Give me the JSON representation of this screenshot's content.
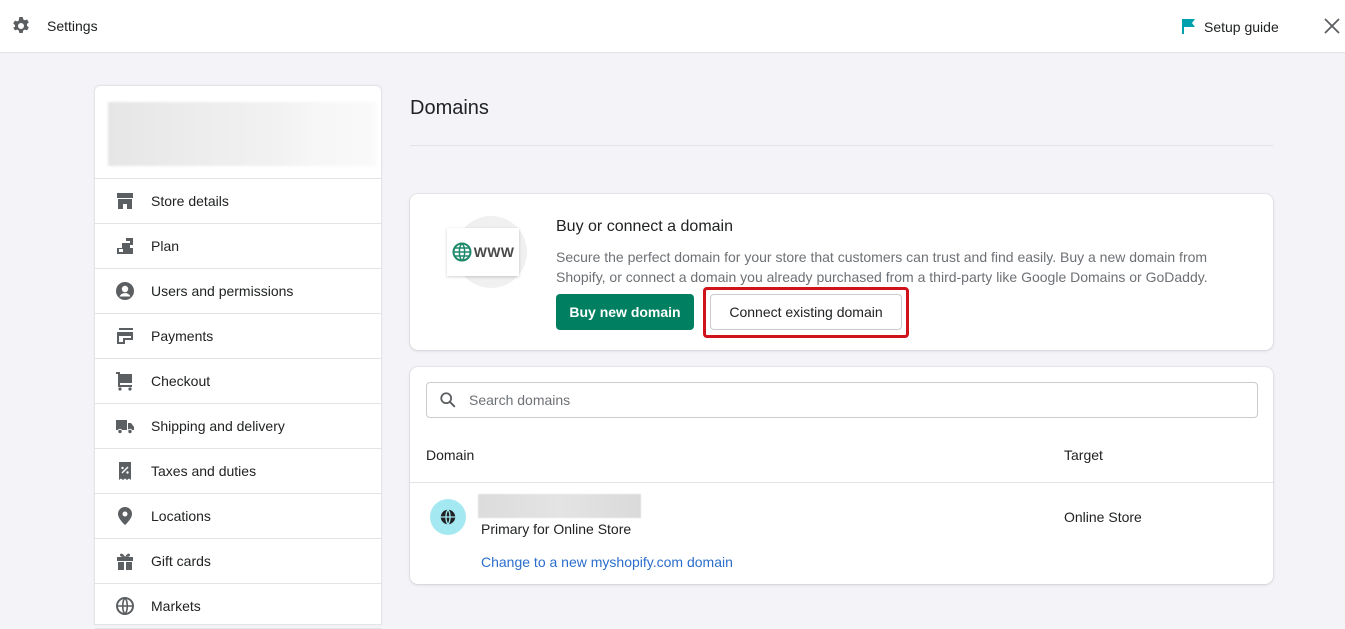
{
  "topbar": {
    "title": "Settings",
    "setup_guide_label": "Setup guide",
    "icons": {
      "settings": "gear-icon",
      "setup": "flag-icon",
      "close": "close-icon"
    }
  },
  "sidebar": {
    "store_name": "",
    "items": [
      {
        "label": "Store details",
        "icon": "store-icon"
      },
      {
        "label": "Plan",
        "icon": "plan-icon"
      },
      {
        "label": "Users and permissions",
        "icon": "user-icon"
      },
      {
        "label": "Payments",
        "icon": "payments-icon"
      },
      {
        "label": "Checkout",
        "icon": "cart-icon"
      },
      {
        "label": "Shipping and delivery",
        "icon": "truck-icon"
      },
      {
        "label": "Taxes and duties",
        "icon": "tax-icon"
      },
      {
        "label": "Locations",
        "icon": "location-pin-icon"
      },
      {
        "label": "Gift cards",
        "icon": "gift-icon"
      },
      {
        "label": "Markets",
        "icon": "globe-icon"
      }
    ]
  },
  "main": {
    "page_title": "Domains",
    "buy_card": {
      "illustration_text": "WWW",
      "title": "Buy or connect a domain",
      "description": "Secure the perfect domain for your store that customers can trust and find easily. Buy a new domain from Shopify, or connect a domain you already purchased from a third-party like Google Domains or GoDaddy.",
      "buy_button_label": "Buy new domain",
      "connect_button_label": "Connect existing domain",
      "highlight_color": "#d0121b"
    },
    "domains_list": {
      "search_placeholder": "Search domains",
      "search_value": "",
      "columns": [
        "Domain",
        "Target"
      ],
      "rows": [
        {
          "domain": "",
          "status": "Primary for Online Store",
          "action_link": "Change to a new myshopify.com domain",
          "target": "Online Store"
        }
      ]
    }
  },
  "colors": {
    "primary_button": "#008060",
    "link": "#2c6ecb",
    "flag": "#00a0ac",
    "avatar_bg": "#a4e8f2",
    "globe_illustration": "#1f8a6b"
  }
}
